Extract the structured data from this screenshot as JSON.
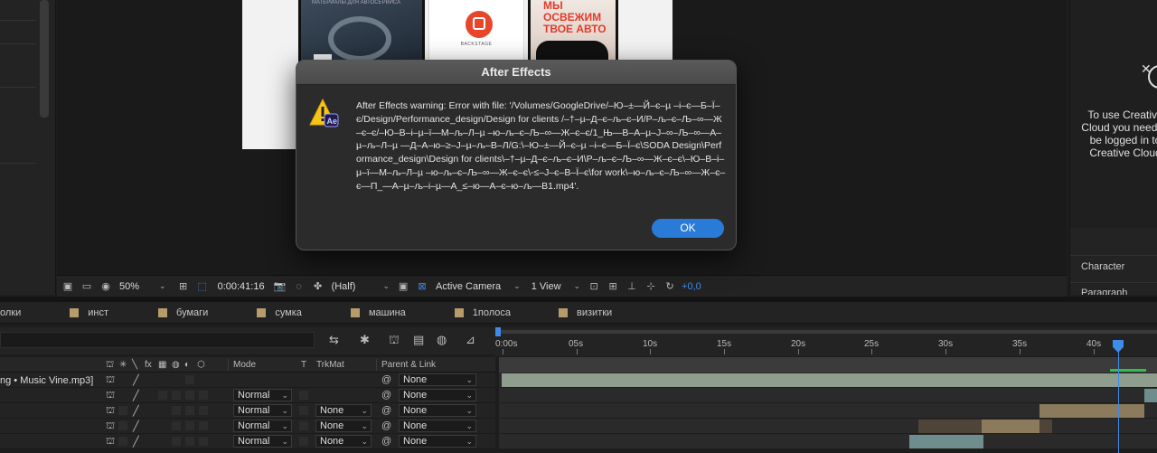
{
  "dialog": {
    "title": "After Effects",
    "icon": "warning-ae-icon",
    "message": "After Effects warning: Error with file: '/Volumes/GoogleDrive/–Ю–±—Й–є–µ –і–є—Б–Ї–є/Design/Performance_design/Design for clients /–†–µ–Д–є–љ–є–И/Р–љ–є–Љ–∞—Ж–є–є/–Ю–В–і–µ–ї—М–љ–Л–µ –ю–љ–є–Љ–∞—Ж–є–є/1_Њ—В–А–µ–Ј–∞–Љ–∞—А–µ–љ–Л–µ —Д–А–ю–≥–Ј–µ–љ–В–Л/G:\\–Ю–±—Й–є–µ –і–є—Б–Ї–є\\SODA Design\\Performance_design\\Design for clients\\–†–µ–Д–є–љ–є–И\\Р–љ–є–Љ–∞—Ж–є–є\\–Ю–В–і–µ–ї—М–љ–Л–µ –ю–љ–є–Љ–∞—Ж–є–є\\-≤–Ј–є–В–Ї–є\\for work\\–ю–љ–є–Љ–∞—Ж–є–є—П_—А–µ–љ–і–µ—А_≤–ю—А–є–ю–љ—В1.mp4'.",
    "ok_label": "OK"
  },
  "preview": {
    "phone1_caption": "МАТЕРИАЛЫ ДЛЯ АВТОСЕРВИСА",
    "phone2_caption": "BACKSTAGE",
    "phone3_title": "МЫ ОСВЕЖИМ ТВОЕ АВТО"
  },
  "right_panel": {
    "cc_message": "To use Creative Cloud you need to be logged in to Creative Cloud",
    "character_label": "Character",
    "paragraph_label": "Paragraph"
  },
  "viewer_toolbar": {
    "zoom": "50%",
    "timecode": "0:00:41:16",
    "resolution": "(Half)",
    "camera": "Active Camera",
    "views": "1 View",
    "exposure": "+0,0"
  },
  "comp_tabs": [
    {
      "label": "олки",
      "swatch": ""
    },
    {
      "label": "инст",
      "swatch": "#b79b6b"
    },
    {
      "label": "бумаги",
      "swatch": "#b79b6b"
    },
    {
      "label": "сумка",
      "swatch": "#b79b6b"
    },
    {
      "label": "машина",
      "swatch": "#b79b6b"
    },
    {
      "label": "1полоса",
      "swatch": "#b79b6b"
    },
    {
      "label": "визитки",
      "swatch": "#b79b6b"
    }
  ],
  "ruler": {
    "labels": [
      "0:00s",
      "05s",
      "10s",
      "15s",
      "20s",
      "25s",
      "30s",
      "35s",
      "40s"
    ]
  },
  "layer_header": {
    "mode": "Mode",
    "t": "T",
    "trkmat": "TrkMat",
    "parent": "Parent & Link"
  },
  "layers": [
    {
      "name": "ng • Music Vine.mp3]",
      "mode": "",
      "trkmat": "",
      "parent": "None"
    },
    {
      "name": "",
      "mode": "Normal",
      "trkmat": "",
      "parent": "None"
    },
    {
      "name": "",
      "mode": "Normal",
      "trkmat": "None",
      "parent": "None"
    },
    {
      "name": "",
      "mode": "Normal",
      "trkmat": "None",
      "parent": "None"
    },
    {
      "name": "",
      "mode": "Normal",
      "trkmat": "None",
      "parent": "None"
    }
  ],
  "colors": {
    "accent": "#2a7bd8",
    "audio_bar": "#8f9d8e",
    "tan_bar": "#8c7a5c",
    "teal_bar": "#6f8d8c"
  }
}
